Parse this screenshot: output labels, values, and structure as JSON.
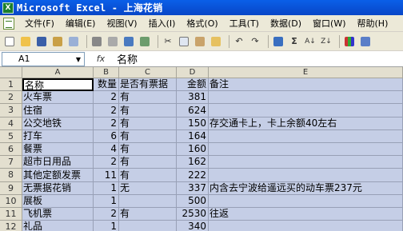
{
  "window": {
    "title": "Microsoft Excel - 上海花销"
  },
  "menu": {
    "items": [
      "文件(F)",
      "编辑(E)",
      "视图(V)",
      "插入(I)",
      "格式(O)",
      "工具(T)",
      "数据(D)",
      "窗口(W)",
      "帮助(H)"
    ]
  },
  "formula_bar": {
    "name_box": "A1",
    "fx": "fx",
    "content": "名称"
  },
  "sheet": {
    "columns": [
      "A",
      "B",
      "C",
      "D",
      "E"
    ],
    "rows": [
      {
        "n": "1",
        "a": "名称",
        "b": "数量",
        "c": "是否有票据",
        "d": "金额",
        "e": "备注"
      },
      {
        "n": "2",
        "a": "火车票",
        "b": "2",
        "c": "有",
        "d": "381",
        "e": ""
      },
      {
        "n": "3",
        "a": "住宿",
        "b": "2",
        "c": "有",
        "d": "624",
        "e": ""
      },
      {
        "n": "4",
        "a": "公交地铁",
        "b": "2",
        "c": "有",
        "d": "150",
        "e": "存交通卡上，卡上余额40左右"
      },
      {
        "n": "5",
        "a": "打车",
        "b": "6",
        "c": "有",
        "d": "164",
        "e": ""
      },
      {
        "n": "6",
        "a": "  餐票",
        "b": "4",
        "c": "有",
        "d": "160",
        "e": ""
      },
      {
        "n": "7",
        "a": "超市日用品",
        "b": "2",
        "c": "有",
        "d": "162",
        "e": ""
      },
      {
        "n": "8",
        "a": "其他定额发票",
        "b": "11",
        "c": "有",
        "d": "222",
        "e": ""
      },
      {
        "n": "9",
        "a": "无票据花销",
        "b": "1",
        "c": "无",
        "d": "337",
        "e": "内含去宁波给遥远买的动车票237元"
      },
      {
        "n": "10",
        "a": "展板",
        "b": "1",
        "c": "",
        "d": "500",
        "e": ""
      },
      {
        "n": "11",
        "a": "飞机票",
        "b": "2",
        "c": "有",
        "d": "2530",
        "e": "往返"
      },
      {
        "n": "12",
        "a": "礼品",
        "b": "1",
        "c": "",
        "d": "340",
        "e": ""
      }
    ]
  }
}
